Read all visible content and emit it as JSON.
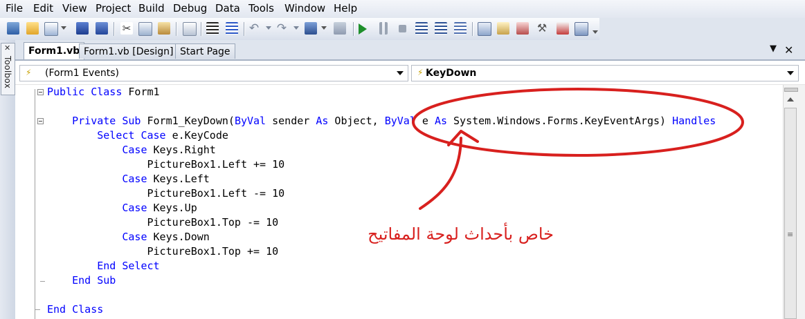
{
  "menu": [
    "File",
    "Edit",
    "View",
    "Project",
    "Build",
    "Debug",
    "Data",
    "Tools",
    "Window",
    "Help"
  ],
  "toolbox": {
    "label": "Toolbox"
  },
  "tabs": [
    {
      "label": "Form1.vb",
      "active": true
    },
    {
      "label": "Form1.vb [Design]",
      "active": false
    },
    {
      "label": "Start Page",
      "active": false
    }
  ],
  "tab_controls": {
    "dropdown": "▼",
    "close": "✕"
  },
  "combos": {
    "object": "(Form1 Events)",
    "event": "KeyDown"
  },
  "code": {
    "line1": [
      "Public",
      " ",
      "Class",
      " Form1"
    ],
    "line3": [
      "    ",
      "Private",
      " ",
      "Sub",
      " Form1_KeyDown(",
      "ByVal",
      " sender ",
      "As",
      " Object, ",
      "ByVal",
      " e ",
      "As",
      " System.Windows.Forms.KeyEventArgs) ",
      "Handles"
    ],
    "line4": [
      "        ",
      "Select",
      " ",
      "Case",
      " e.KeyCode"
    ],
    "line5": [
      "            ",
      "Case",
      " Keys.Right"
    ],
    "line6": [
      "                PictureBox1.Left += 10"
    ],
    "line7": [
      "            ",
      "Case",
      " Keys.Left"
    ],
    "line8": [
      "                PictureBox1.Left -= 10"
    ],
    "line9": [
      "            ",
      "Case",
      " Keys.Up"
    ],
    "line10": [
      "                PictureBox1.Top -= 10"
    ],
    "line11": [
      "            ",
      "Case",
      " Keys.Down"
    ],
    "line12": [
      "                PictureBox1.Top += 10"
    ],
    "line13": [
      "        ",
      "End",
      " ",
      "Select"
    ],
    "line14": [
      "    ",
      "End",
      " ",
      "Sub"
    ],
    "line16": [
      "End",
      " ",
      "Class"
    ]
  },
  "annotation": {
    "text": "خاص بأحداث لوحة المفاتيح",
    "color": "#d8201e"
  },
  "colors": {
    "keyword": "#0000ff",
    "annotation_red": "#d8201e"
  }
}
